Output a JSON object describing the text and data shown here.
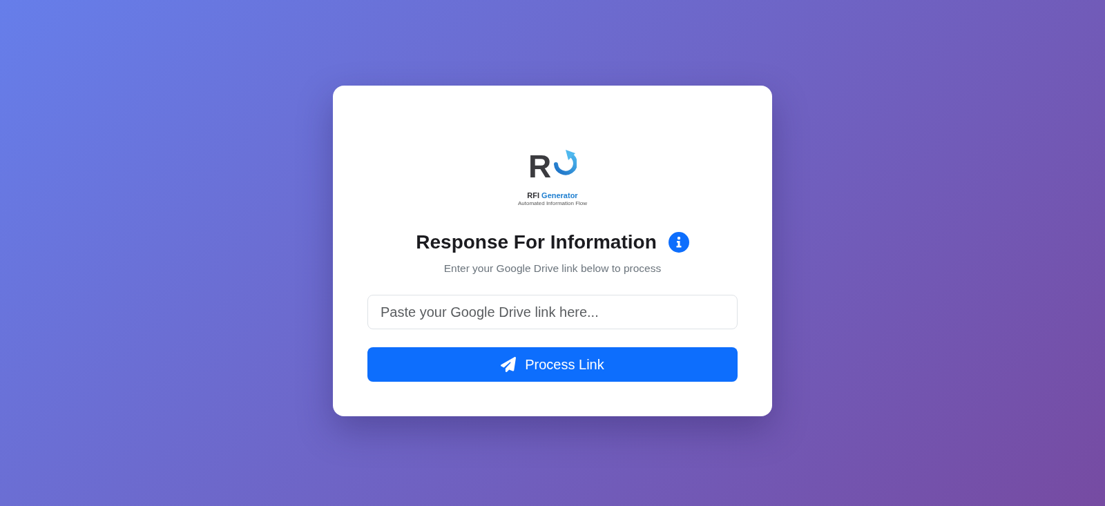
{
  "logo": {
    "mark": "R",
    "name": "RFI",
    "name_accent": "Generator",
    "tagline": "Automated Information Flow"
  },
  "header": {
    "title": "Response For Information",
    "subtitle": "Enter your Google Drive link below to process"
  },
  "link_field": {
    "placeholder": "Paste your Google Drive link here..."
  },
  "submit_button": {
    "label": "Process Link"
  }
}
